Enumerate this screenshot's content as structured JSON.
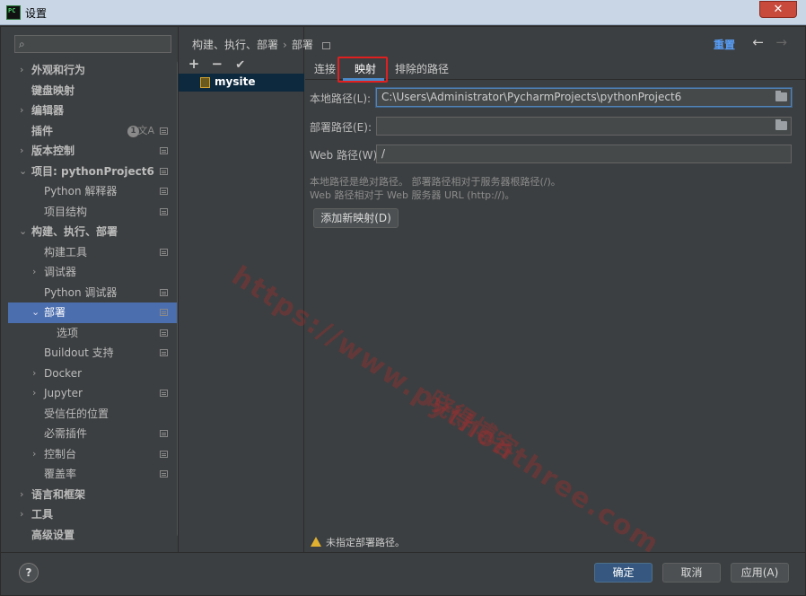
{
  "window": {
    "title": "设置",
    "app_icon": "PC",
    "close_label": "✕"
  },
  "search": {
    "placeholder": ""
  },
  "tree": {
    "items": [
      {
        "label": "外观和行为"
      },
      {
        "label": "键盘映射"
      },
      {
        "label": "编辑器"
      },
      {
        "label": "插件",
        "badge": "1"
      },
      {
        "label": "版本控制"
      },
      {
        "label": "项目: pythonProject6"
      },
      {
        "label": "Python 解释器"
      },
      {
        "label": "项目结构"
      },
      {
        "label": "构建、执行、部署"
      },
      {
        "label": "构建工具"
      },
      {
        "label": "调试器"
      },
      {
        "label": "Python 调试器"
      },
      {
        "label": "部署"
      },
      {
        "label": "选项"
      },
      {
        "label": "Buildout 支持"
      },
      {
        "label": "Docker"
      },
      {
        "label": "Jupyter"
      },
      {
        "label": "受信任的位置"
      },
      {
        "label": "必需插件"
      },
      {
        "label": "控制台"
      },
      {
        "label": "覆盖率"
      },
      {
        "label": "语言和框架"
      },
      {
        "label": "工具"
      },
      {
        "label": "高级设置"
      }
    ]
  },
  "servers": {
    "toolbar": {
      "add": "+",
      "remove": "−",
      "apply": "✔"
    },
    "items": [
      {
        "name": "mysite"
      }
    ]
  },
  "breadcrumb": {
    "part1": "构建、执行、部署",
    "sep": "›",
    "part2": "部署"
  },
  "header": {
    "reset": "重置",
    "back": "←",
    "forward": "→"
  },
  "tabs": [
    {
      "label": "连接"
    },
    {
      "label": "映射"
    },
    {
      "label": "排除的路径"
    }
  ],
  "mapping": {
    "local_path_label": "本地路径(L):",
    "local_path_value": "C:\\Users\\Administrator\\PycharmProjects\\pythonProject6",
    "deploy_path_label": "部署路径(E):",
    "deploy_path_value": "",
    "web_path_label": "Web 路径(W):",
    "web_path_value": "/",
    "hint_line1": "本地路径是绝对路径。 部署路径相对于服务器根路径(/)。",
    "hint_line2": "Web 路径相对于 Web 服务器 URL (http://)。",
    "add_mapping": "添加新映射(D)",
    "warning": "未指定部署路径。"
  },
  "footer": {
    "help": "?",
    "ok": "确定",
    "cancel": "取消",
    "apply": "应用(A)"
  },
  "watermark": {
    "url": "https://www.pythonthree.com",
    "brand": "晓得博客"
  },
  "colors": {
    "selection": "#4b6eaf",
    "link": "#589df6",
    "highlight_box": "#e02020",
    "background": "#3c3f41"
  }
}
